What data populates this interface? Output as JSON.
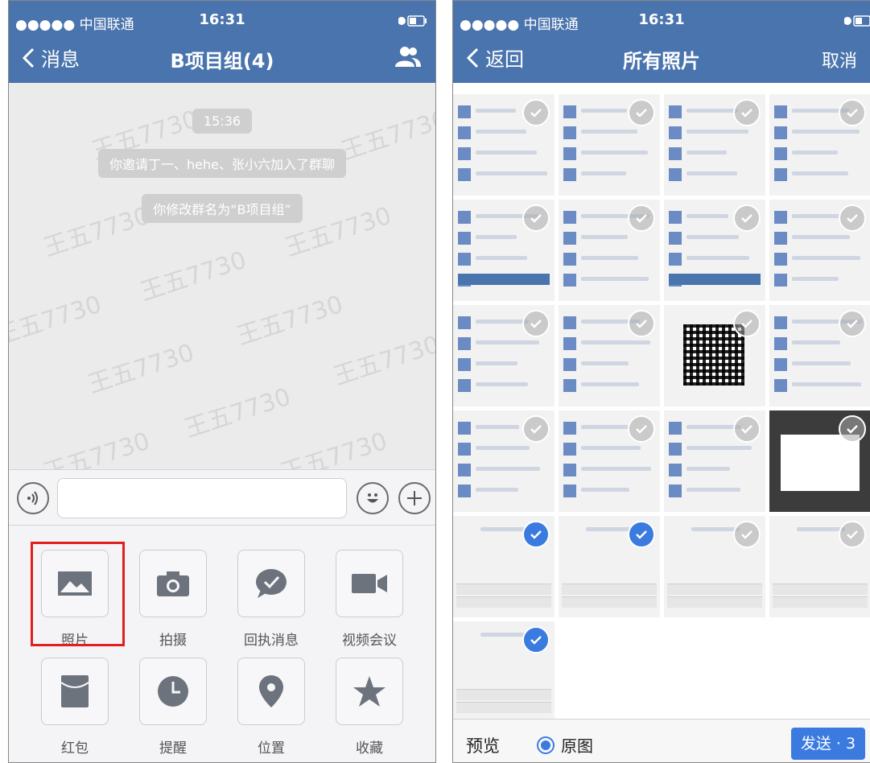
{
  "left": {
    "status": {
      "carrier": "●●●●● 中国联通 ",
      "time": "16:31"
    },
    "nav": {
      "back_label": "消息",
      "title": "B项目组(4)"
    },
    "chat": {
      "timestamp": "15:36",
      "system_messages": [
        "你邀请丁一、hehe、张小六加入了群聊",
        "你修改群名为“B项目组”"
      ],
      "watermark": "王五7730"
    },
    "tools": [
      {
        "label": "照片",
        "icon": "photo-icon"
      },
      {
        "label": "拍摄",
        "icon": "camera-icon"
      },
      {
        "label": "回执消息",
        "icon": "receipt-message-icon"
      },
      {
        "label": "视频会议",
        "icon": "video-icon"
      },
      {
        "label": "红包",
        "icon": "red-packet-icon"
      },
      {
        "label": "提醒",
        "icon": "clock-icon"
      },
      {
        "label": "位置",
        "icon": "location-icon"
      },
      {
        "label": "收藏",
        "icon": "star-icon"
      }
    ],
    "highlight_color": "#e02020"
  },
  "right": {
    "status": {
      "carrier": "●●●●● 中国联通 ",
      "time": "16:31"
    },
    "nav": {
      "back_label": "返回",
      "title": "所有照片",
      "cancel_label": "取消"
    },
    "photos": [
      {
        "checked": false
      },
      {
        "checked": false
      },
      {
        "checked": false
      },
      {
        "checked": false
      },
      {
        "checked": false
      },
      {
        "checked": false
      },
      {
        "checked": false
      },
      {
        "checked": false
      },
      {
        "checked": false
      },
      {
        "checked": false
      },
      {
        "checked": false
      },
      {
        "checked": false
      },
      {
        "checked": false
      },
      {
        "checked": false
      },
      {
        "checked": false
      },
      {
        "checked": false
      },
      {
        "checked": true
      },
      {
        "checked": true
      },
      {
        "checked": false
      },
      {
        "checked": false
      },
      {
        "checked": true
      }
    ],
    "bottom": {
      "preview_label": "预览",
      "original_label": "原图",
      "send_label": "发送 · 3"
    },
    "accent_color": "#3b7be0"
  },
  "brand_color": "#4a74ad"
}
